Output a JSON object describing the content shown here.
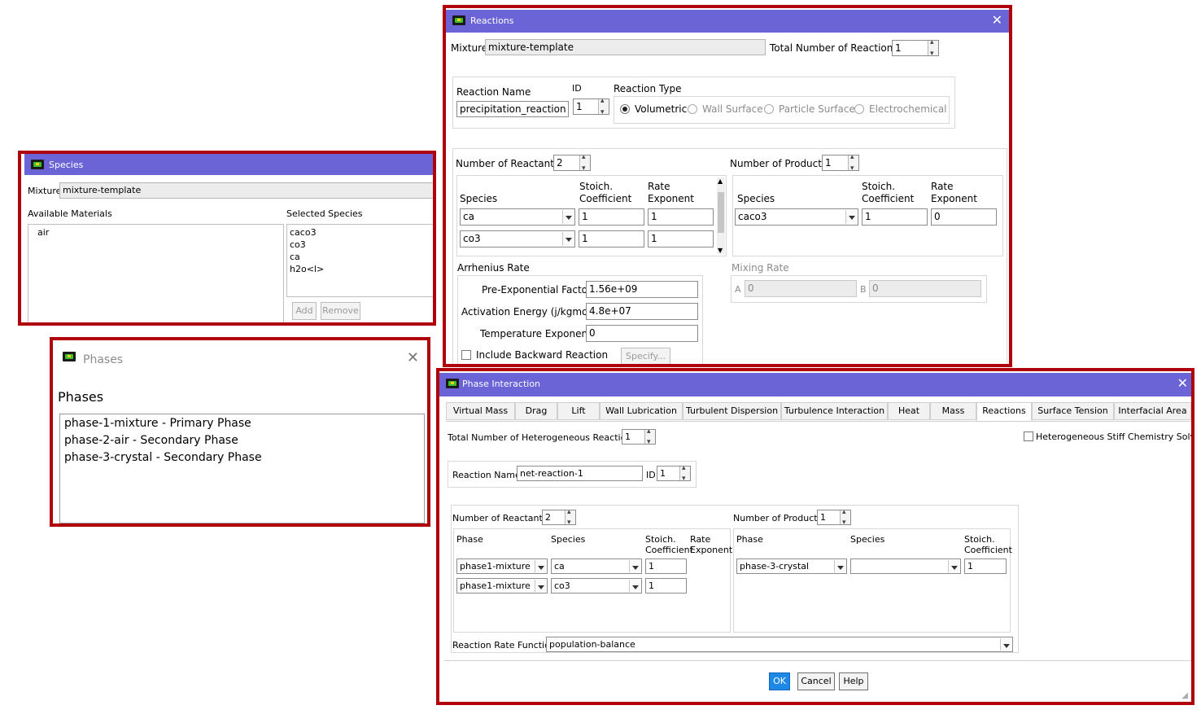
{
  "reactions": {
    "title": "Reactions",
    "mixture_label": "Mixture",
    "mixture_value": "mixture-template",
    "total_label": "Total Number of Reactions",
    "total_value": "1",
    "reaction_name_label": "Reaction Name",
    "reaction_name_value": "precipitation_reaction",
    "id_label": "ID",
    "id_value": "1",
    "reaction_type_label": "Reaction Type",
    "types": [
      "Volumetric",
      "Wall Surface",
      "Particle Surface",
      "Electrochemical"
    ],
    "num_reactants_label": "Number of Reactants",
    "num_reactants_value": "2",
    "num_products_label": "Number of Products",
    "num_products_value": "1",
    "col_species": "Species",
    "col_stoich_1": "Stoich.",
    "col_stoich_2": "Coefficient",
    "col_rate_1": "Rate",
    "col_rate_2": "Exponent",
    "reactants": [
      {
        "species": "ca",
        "stoich": "1",
        "rate": "1"
      },
      {
        "species": "co3",
        "stoich": "1",
        "rate": "1"
      }
    ],
    "products": [
      {
        "species": "caco3",
        "stoich": "1",
        "rate": "0"
      }
    ],
    "arrhenius_label": "Arrhenius Rate",
    "preexp_label": "Pre-Exponential Factor",
    "preexp_value": "1.56e+09",
    "activation_label": "Activation Energy (j/kgmol)",
    "activation_value": "4.8e+07",
    "temp_exp_label": "Temperature Exponent",
    "temp_exp_value": "0",
    "backward_label": "Include Backward Reaction",
    "specify_label": "Specify...",
    "mixing_label": "Mixing Rate",
    "mix_a_label": "A",
    "mix_a_value": "0",
    "mix_b_label": "B",
    "mix_b_value": "0"
  },
  "species": {
    "title": "Species",
    "mixture_label": "Mixture",
    "mixture_value": "mixture-template",
    "available_label": "Available Materials",
    "selected_label": "Selected Species",
    "available": [
      "air"
    ],
    "selected": [
      "caco3",
      "co3",
      "ca",
      "h2o<l>"
    ],
    "add_label": "Add",
    "remove_label": "Remove"
  },
  "phases": {
    "title": "Phases",
    "heading": "Phases",
    "items": [
      "phase-1-mixture - Primary Phase",
      "phase-2-air - Secondary Phase",
      "phase-3-crystal - Secondary Phase"
    ]
  },
  "interaction": {
    "title": "Phase Interaction",
    "tabs": [
      "Virtual Mass",
      "Drag",
      "Lift",
      "Wall Lubrication",
      "Turbulent Dispersion",
      "Turbulence Interaction",
      "Heat",
      "Mass",
      "Reactions",
      "Surface Tension",
      "Interfacial Area"
    ],
    "active_tab": "Reactions",
    "total_label": "Total Number of Heterogeneous Reactions",
    "total_value": "1",
    "stiff_label": "Heterogeneous Stiff Chemistry Solver",
    "reaction_name_label": "Reaction Name",
    "reaction_name_value": "net-reaction-1",
    "id_label": "ID",
    "id_value": "1",
    "num_reactants_label": "Number of Reactants",
    "num_reactants_value": "2",
    "num_products_label": "Number of Products",
    "num_products_value": "1",
    "col_phase": "Phase",
    "col_species": "Species",
    "col_stoich_1": "Stoich.",
    "col_stoich_2": "Coefficient",
    "col_rate_1": "Rate",
    "col_rate_2": "Exponent",
    "reactants": [
      {
        "phase": "phase1-mixture",
        "species": "ca",
        "stoich": "1"
      },
      {
        "phase": "phase1-mixture",
        "species": "co3",
        "stoich": "1"
      }
    ],
    "products": [
      {
        "phase": "phase-3-crystal",
        "species": "",
        "stoich": "1"
      }
    ],
    "rate_fn_label": "Reaction Rate Function",
    "rate_fn_value": "population-balance",
    "ok_label": "OK",
    "cancel_label": "Cancel",
    "help_label": "Help"
  }
}
